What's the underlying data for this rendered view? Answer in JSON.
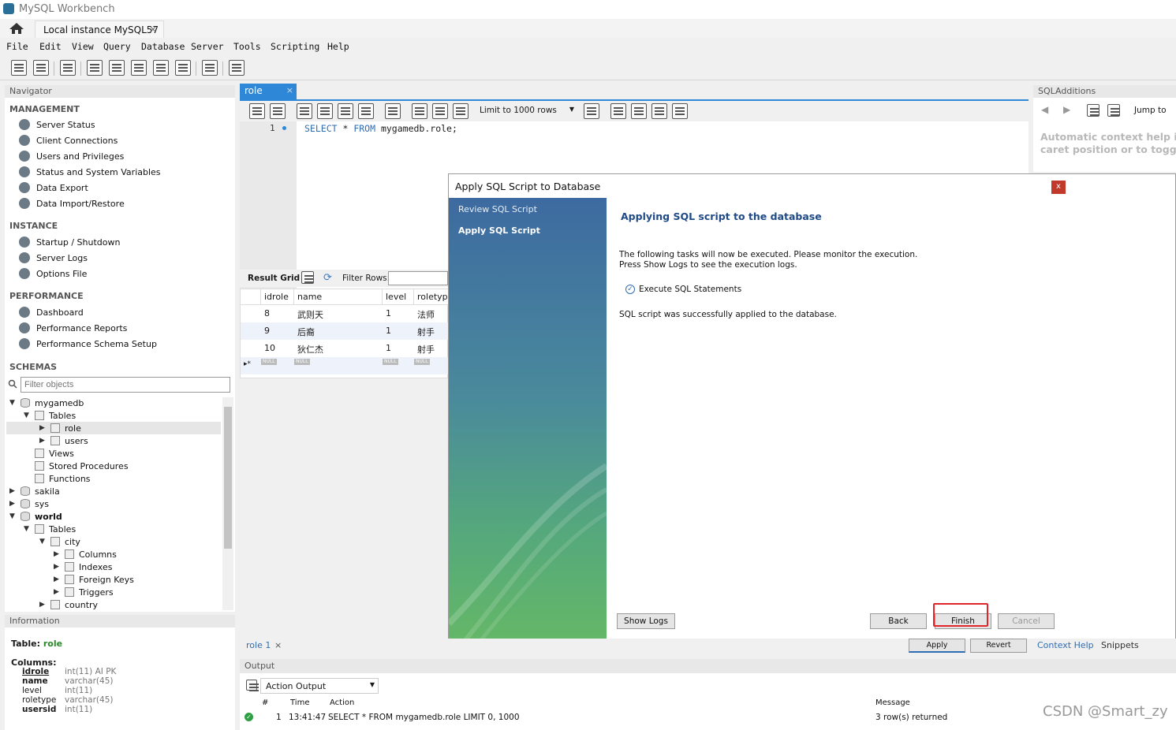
{
  "window": {
    "title": "MySQL Workbench",
    "connection_tab": "Local instance MySQL57",
    "close_glyph": "×"
  },
  "menu": [
    "File",
    "Edit",
    "View",
    "Query",
    "Database",
    "Server",
    "Tools",
    "Scripting",
    "Help"
  ],
  "navigator": {
    "title": "Navigator",
    "management": {
      "header": "MANAGEMENT",
      "items": [
        "Server Status",
        "Client Connections",
        "Users and Privileges",
        "Status and System Variables",
        "Data Export",
        "Data Import/Restore"
      ]
    },
    "instance": {
      "header": "INSTANCE",
      "items": [
        "Startup / Shutdown",
        "Server Logs",
        "Options File"
      ]
    },
    "performance": {
      "header": "PERFORMANCE",
      "items": [
        "Dashboard",
        "Performance Reports",
        "Performance Schema Setup"
      ]
    },
    "schemas": {
      "header": "SCHEMAS",
      "filter_placeholder": "Filter objects",
      "tree": [
        "mygamedb",
        "Tables",
        "role",
        "users",
        "Views",
        "Stored Procedures",
        "Functions",
        "sakila",
        "sys",
        "world",
        "Tables",
        "city",
        "Columns",
        "Indexes",
        "Foreign Keys",
        "Triggers",
        "country"
      ]
    }
  },
  "information": {
    "title": "Information",
    "table_label": "Table:",
    "table_name": "role",
    "columns_label": "Columns:",
    "columns": [
      {
        "name": "idrole",
        "type": "int(11) AI PK"
      },
      {
        "name": "name",
        "type": "varchar(45)"
      },
      {
        "name": "level",
        "type": "int(11)"
      },
      {
        "name": "roletype",
        "type": "varchar(45)"
      },
      {
        "name": "usersid",
        "type": "int(11)"
      }
    ]
  },
  "editor": {
    "tab": "role",
    "limit": "Limit to 1000 rows",
    "line_number": "1",
    "sql_kw1": "SELECT",
    "sql_mid": " * ",
    "sql_kw2": "FROM",
    "sql_rest": " mygamedb.role;"
  },
  "result": {
    "label": "Result Grid",
    "filter_label": "Filter Rows:",
    "columns": [
      "idrole",
      "name",
      "level",
      "roletype"
    ],
    "rows": [
      [
        "8",
        "武则天",
        "1",
        "法师"
      ],
      [
        "9",
        "后裔",
        "1",
        "射手"
      ],
      [
        "10",
        "狄仁杰",
        "1",
        "射手"
      ]
    ],
    "null_label": "NULL"
  },
  "sqladditions": {
    "title": "SQLAdditions",
    "jump_to": "Jump to",
    "help_line1": "Automatic context help is",
    "help_line2": "caret position or to toggle"
  },
  "dialog": {
    "title": "Apply SQL Script to Database",
    "close": "x",
    "steps": [
      "Review SQL Script",
      "Apply SQL Script"
    ],
    "heading": "Applying SQL script to the database",
    "info1": "The following tasks will now be executed. Please monitor the execution.",
    "info2": "Press Show Logs to see the execution logs.",
    "task": "Execute SQL Statements",
    "success": "SQL script was successfully applied to the database.",
    "show_logs": "Show Logs",
    "back": "Back",
    "finish": "Finish",
    "cancel": "Cancel"
  },
  "bottom": {
    "query_tab": "role 1",
    "apply": "Apply",
    "revert": "Revert",
    "context_help": "Context Help",
    "snippets": "Snippets"
  },
  "output": {
    "title": "Output",
    "mode": "Action Output",
    "headers": {
      "num": "#",
      "time": "Time",
      "action": "Action",
      "message": "Message"
    },
    "row": {
      "num": "1",
      "time": "13:41:47",
      "action": "SELECT * FROM mygamedb.role LIMIT 0, 1000",
      "message": "3 row(s) returned"
    }
  },
  "watermark": "CSDN @Smart_zy"
}
